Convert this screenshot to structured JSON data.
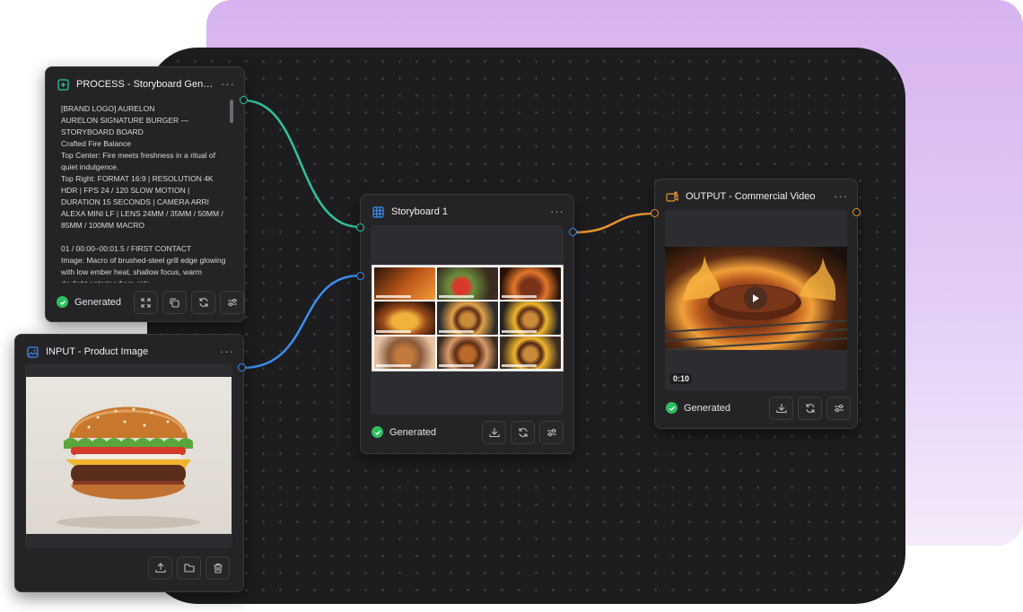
{
  "canvas": {
    "background": "#1d1d20",
    "accent_backdrop": "#d6b3ef"
  },
  "process_node": {
    "title": "PROCESS - Storyboard Gener...",
    "icon": "plus-square-icon",
    "body_text": "[BRAND LOGO] AURELON\nAURELON SIGNATURE BURGER —\nSTORYBOARD BOARD\nCrafted Fire Balance\nTop Center: Fire meets freshness in a ritual of quiet indulgence.\nTop Right: FORMAT 16:9 | RESOLUTION 4K HDR | FPS 24 / 120 SLOW MOTION | DURATION 15 SECONDS | CAMERA ARRI ALEXA MINI LF | LENS 24MM / 35MM / 50MM / 85MM / 100MM MACRO\n\n01 / 00:00–00:01.5 / FIRST CONTACT\nImage: Macro of brushed-steel grill edge glowing with low ember heat, shallow focus, warm daylight entering from side-",
    "status": "Generated",
    "buttons": [
      "fullscreen-icon",
      "copy-icon",
      "refresh-icon",
      "settings-sliders-icon"
    ]
  },
  "input_node": {
    "title": "INPUT - Product Image",
    "icon": "image-icon",
    "buttons": [
      "upload-icon",
      "folder-icon",
      "trash-icon"
    ]
  },
  "storyboard_node": {
    "title": "Storyboard 1",
    "icon": "grid-icon",
    "status": "Generated",
    "buttons": [
      "download-icon",
      "refresh-icon",
      "settings-sliders-icon"
    ]
  },
  "output_node": {
    "title": "OUTPUT - Commercial Video",
    "icon": "video-camera-icon",
    "duration": "0:10",
    "status": "Generated",
    "buttons": [
      "download-icon",
      "refresh-icon",
      "settings-sliders-icon"
    ]
  },
  "wire_colors": {
    "text": "#2ec4a0",
    "image": "#3b8ff0",
    "video": "#e8932d"
  }
}
